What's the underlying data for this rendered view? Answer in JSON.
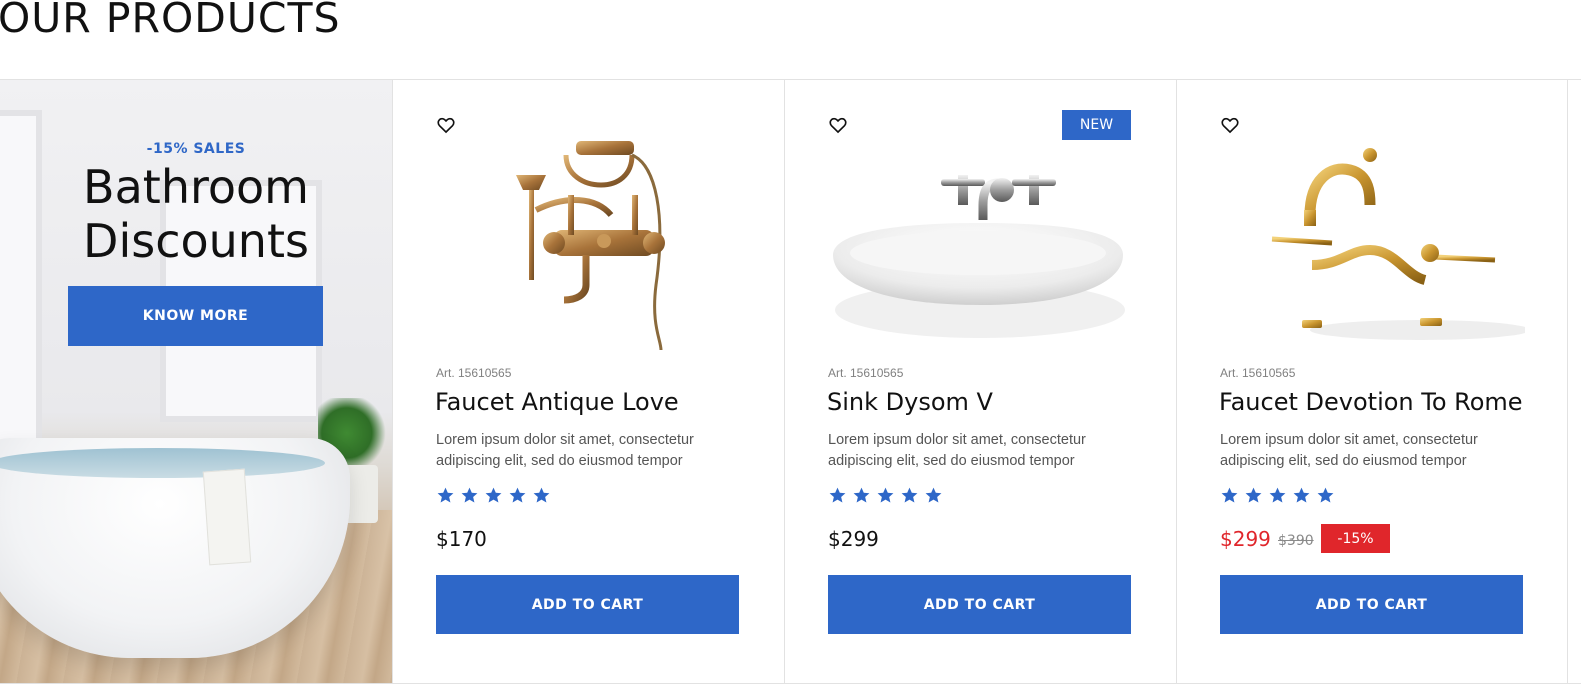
{
  "section": {
    "title": "OUR PRODUCTS"
  },
  "promo": {
    "sales_label": "-15% SALES",
    "title_line1": "Bathroom",
    "title_line2": "Discounts",
    "button_label": "KNOW MORE"
  },
  "colors": {
    "accent": "#2e67c8",
    "sale": "#e0262b",
    "star": "#2e67c8"
  },
  "products": [
    {
      "icon": "heart-icon",
      "image": "antique-brass-faucet-image",
      "art": "Art. 15610565",
      "name": "Faucet Antique Love",
      "desc_line1": "Lorem ipsum dolor sit amet, consectetur",
      "desc_line2": "adipiscing elit, sed do eiusmod tempor",
      "rating": 5,
      "price": "$170",
      "cart_label": "ADD TO CART"
    },
    {
      "icon": "heart-icon",
      "badge": "NEW",
      "image": "sink-basin-image",
      "art": "Art. 15610565",
      "name": "Sink Dysom V",
      "desc_line1": "Lorem ipsum dolor sit amet, consectetur",
      "desc_line2": "adipiscing elit, sed do eiusmod tempor",
      "rating": 5,
      "price": "$299",
      "cart_label": "ADD TO CART"
    },
    {
      "icon": "heart-icon",
      "image": "gold-bridge-faucet-image",
      "art": "Art. 15610565",
      "name": "Faucet Devotion To Rome",
      "desc_line1": "Lorem ipsum dolor sit amet, consectetur",
      "desc_line2": "adipiscing elit, sed do eiusmod tempor",
      "rating": 5,
      "price": "$299",
      "old_price": "$390",
      "discount": "-15%",
      "cart_label": "ADD TO CART"
    }
  ]
}
